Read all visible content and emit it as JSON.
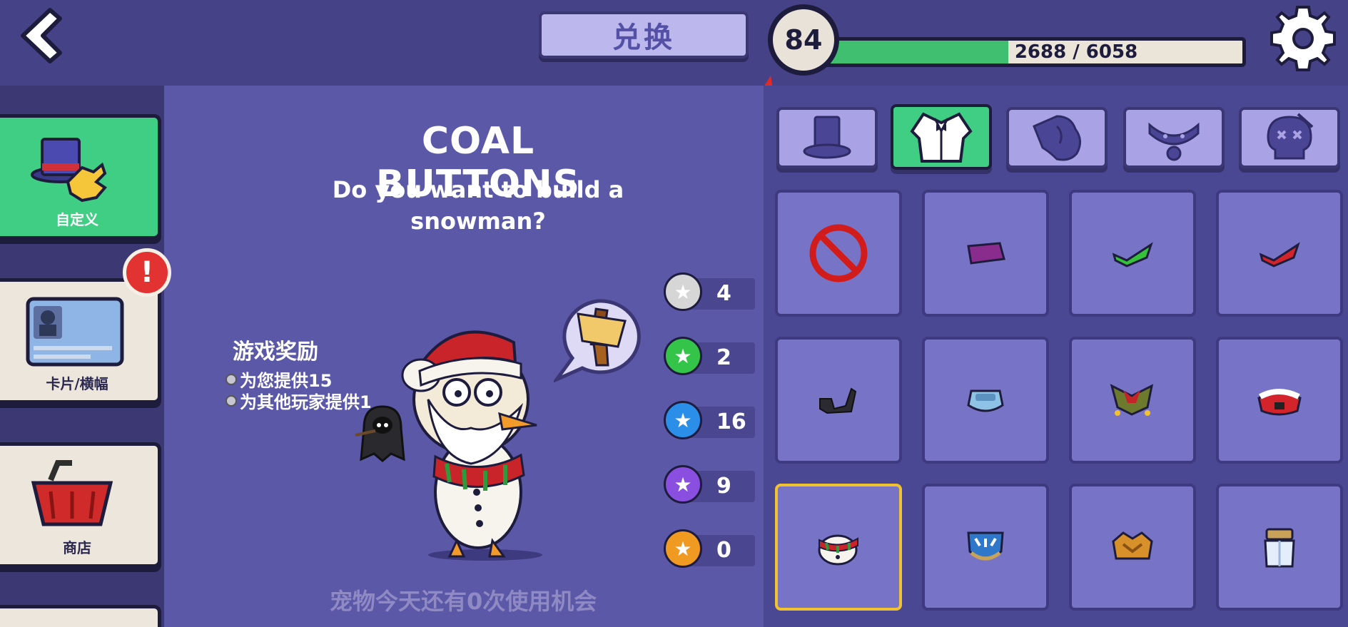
{
  "topbar": {
    "redeem_label": "兑换",
    "level": "84",
    "xp_text": "2688 / 6058",
    "xp_progress": 0.44
  },
  "sidebar": {
    "items": [
      {
        "label": "自定义",
        "icon": "hat-glove-icon",
        "active": true
      },
      {
        "label": "卡片/横幅",
        "icon": "id-card-icon",
        "active": false,
        "alert": "!"
      },
      {
        "label": "商店",
        "icon": "basket-icon",
        "active": false
      }
    ]
  },
  "item": {
    "title": "COAL BUTTONS",
    "description": "Do you want to build a snowman?"
  },
  "rewards": {
    "title": "游戏奖励",
    "line1": "为您提供15",
    "line2": "为其他玩家提供1"
  },
  "pet_usage": "宠物今天还有0次使用机会",
  "stars": [
    {
      "count": "4",
      "color": "#d6d6d6"
    },
    {
      "count": "2",
      "color": "#34c44a"
    },
    {
      "count": "16",
      "color": "#2b8ee8"
    },
    {
      "count": "9",
      "color": "#8a4ee0"
    },
    {
      "count": "0",
      "color": "#f09a22"
    }
  ],
  "category_tabs": [
    {
      "name": "hat-icon",
      "active": false
    },
    {
      "name": "suit-icon",
      "active": true
    },
    {
      "name": "cloak-icon",
      "active": false
    },
    {
      "name": "collar-icon",
      "active": false
    },
    {
      "name": "skull-icon",
      "active": false
    }
  ],
  "colors": {
    "accent_green": "#3fce83",
    "highlight_yellow": "#f2c12e",
    "alert_red": "#e23232"
  }
}
